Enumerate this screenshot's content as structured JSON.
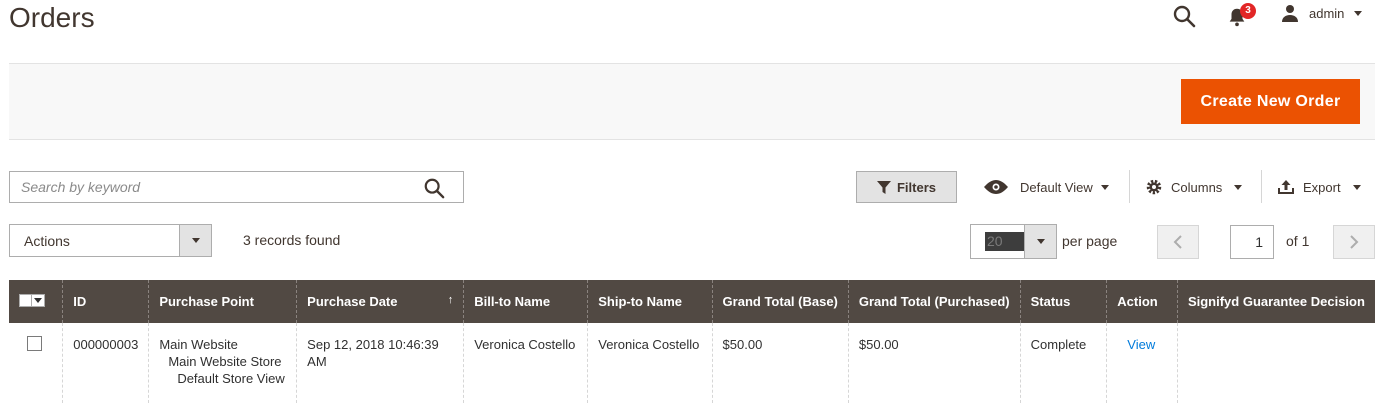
{
  "page": {
    "title": "Orders"
  },
  "header": {
    "notifications_count": "3",
    "user_name": "admin"
  },
  "action_bar": {
    "create_button": "Create New Order"
  },
  "toolbar": {
    "search_placeholder": "Search by keyword",
    "filters_label": "Filters",
    "view_label": "Default View",
    "columns_label": "Columns",
    "export_label": "Export"
  },
  "mass_actions": {
    "actions_label": "Actions",
    "records_found": "3 records found"
  },
  "pagination": {
    "per_page_value": "20",
    "per_page_label": "per page",
    "current_page": "1",
    "of_pages": "of 1"
  },
  "grid": {
    "columns": [
      "ID",
      "Purchase Point",
      "Purchase Date",
      "Bill-to Name",
      "Ship-to Name",
      "Grand Total (Base)",
      "Grand Total (Purchased)",
      "Status",
      "Action",
      "Signifyd Guarantee Decision"
    ],
    "sort_indicator": "↑",
    "rows": [
      {
        "id": "000000003",
        "purchase_point": [
          "Main Website",
          "Main Website Store",
          "Default Store View"
        ],
        "purchase_date": "Sep 12, 2018 10:46:39 AM",
        "bill_to": "Veronica Costello",
        "ship_to": "Veronica Costello",
        "total_base": "$50.00",
        "total_purchased": "$50.00",
        "status": "Complete",
        "action": "View",
        "signifyd": ""
      }
    ]
  },
  "colors": {
    "accent": "#eb5202",
    "grid_header": "#514943",
    "link": "#007bdb",
    "badge": "#e22626"
  }
}
